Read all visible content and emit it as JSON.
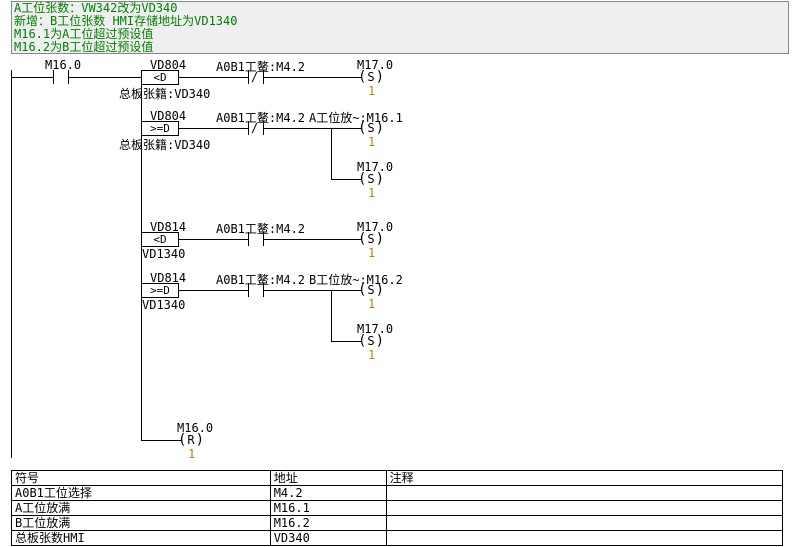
{
  "comments": {
    "l1": "A工位张数：VW342改为VD340",
    "l2": "新增：B工位张数 HMI存储地址为VD1340",
    "l3": "M16.1为A工位超过预设值",
    "l4": "M16.2为B工位超过预设值"
  },
  "ladder": {
    "c_m160": "M16.0",
    "cmp1": {
      "top": "VD804",
      "op": "<D",
      "bot": "总板张籍:VD340"
    },
    "cmp2": {
      "top": "VD804",
      "op": ">=D",
      "bot": "总板张籍:VD340"
    },
    "cmp3": {
      "top": "VD814",
      "op": "<D",
      "bot": "VD1340"
    },
    "cmp4": {
      "top": "VD814",
      "op": ">=D",
      "bot": "VD1340"
    },
    "nc1": "A0B1工鳌:M4.2",
    "nc2": "A0B1工鳌:M4.2",
    "nc3": "A0B1工鳌:M4.2",
    "nc4": "A0B1工鳌:M4.2",
    "out1": {
      "lbl": "M17.0",
      "type": "S",
      "n": "1"
    },
    "out2a": {
      "lbl": "A工位放~:M16.1",
      "type": "S",
      "n": "1"
    },
    "out2b": {
      "lbl": "M17.0",
      "type": "S",
      "n": "1"
    },
    "out3": {
      "lbl": "M17.0",
      "type": "S",
      "n": "1"
    },
    "out4a": {
      "lbl": "B工位放~:M16.2",
      "type": "S",
      "n": "1"
    },
    "out4b": {
      "lbl": "M17.0",
      "type": "S",
      "n": "1"
    },
    "out5": {
      "lbl": "M16.0",
      "type": "R",
      "n": "1"
    }
  },
  "table": {
    "h_sym": "符号",
    "h_addr": "地址",
    "h_com": "注释",
    "rows": [
      {
        "sym": "A0B1工位选择",
        "addr": "M4.2",
        "com": ""
      },
      {
        "sym": "A工位放满",
        "addr": "M16.1",
        "com": ""
      },
      {
        "sym": "B工位放满",
        "addr": "M16.2",
        "com": ""
      },
      {
        "sym": "总板张数HMI",
        "addr": "VD340",
        "com": ""
      }
    ]
  }
}
